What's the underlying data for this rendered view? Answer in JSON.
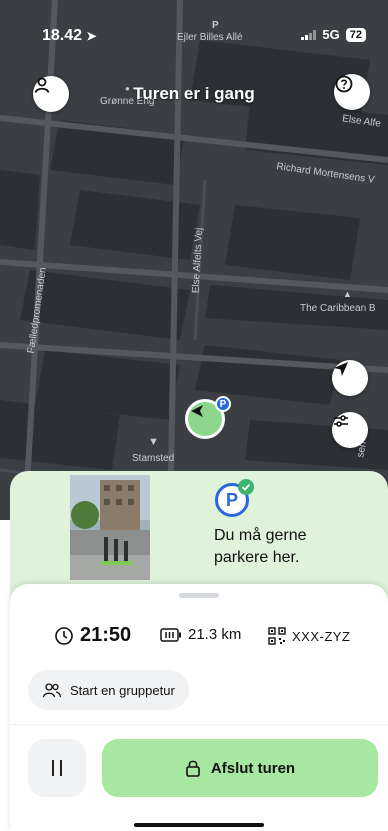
{
  "status_bar": {
    "time": "18.42",
    "network": "5G",
    "battery": "72"
  },
  "map": {
    "ride_status": "Turen er i gang",
    "labels": {
      "top_p": "P",
      "ejler_billes_alle": "Ejler Billes Allé",
      "gronne_eng": "Grønne Eng",
      "else_alfelt": "Else Alfe",
      "richard_mortensens": "Richard Mortensens V",
      "else_alfelts_vej": "Else Alfelts Vej",
      "faelledpromenaden": "Fælledpromenaden",
      "caribbean": "The Caribbean B",
      "stamsted": "Stamsted",
      "lower_right": "sen"
    },
    "pin_badge": "P"
  },
  "parking": {
    "badge": "P",
    "message": "Du må gerne parkere her."
  },
  "trip": {
    "elapsed": "21:50",
    "distance": "21.3 km",
    "vehicle_code": "XXX-ZYZ"
  },
  "actions": {
    "group_ride": "Start en gruppetur",
    "end_ride": "Afslut turen"
  }
}
